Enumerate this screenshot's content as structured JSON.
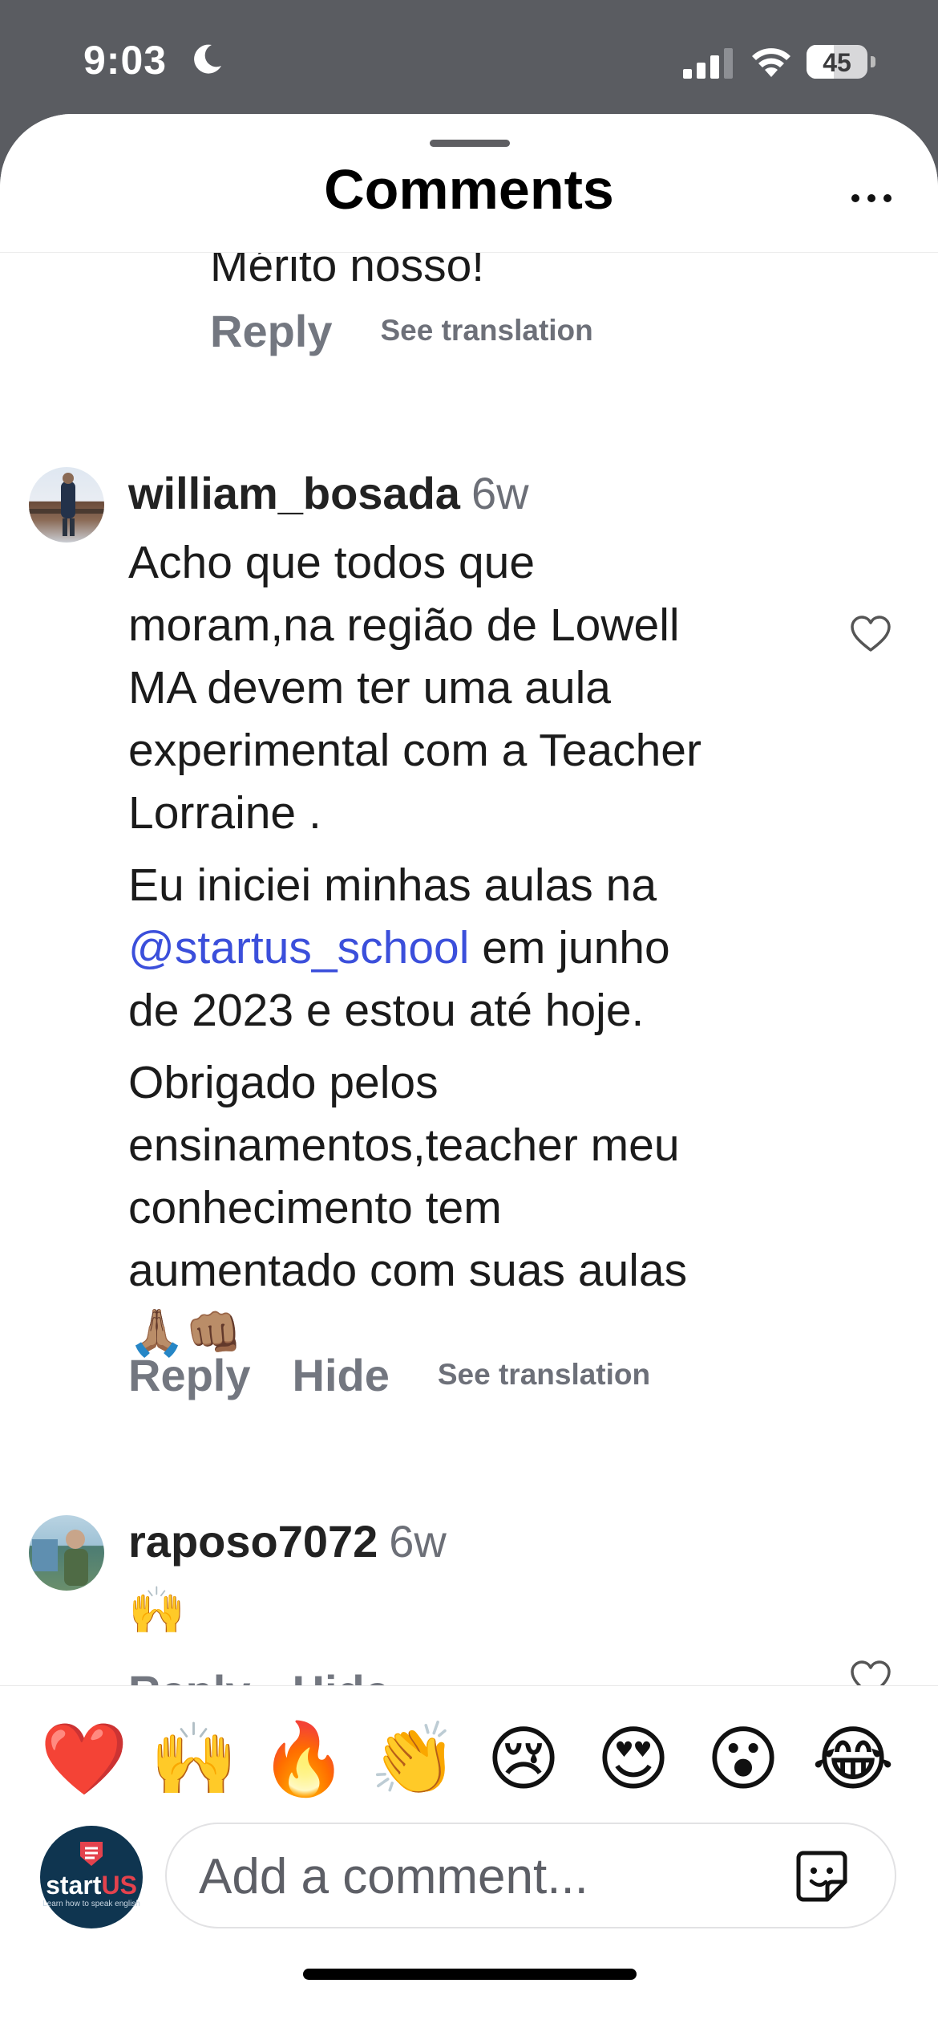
{
  "status_bar": {
    "time": "9:03",
    "battery": "45",
    "battery_level": 0.45
  },
  "header": {
    "title": "Comments"
  },
  "comments": [
    {
      "text_lines": [
        "Mérito nosso!"
      ],
      "actions": {
        "reply": "Reply",
        "translate": "See translation"
      }
    },
    {
      "username": "william_bosada",
      "age": "6w",
      "para1_lines": [
        "Acho que todos que",
        "moram,na região de Lowell",
        "MA devem ter uma aula",
        "experimental com a Teacher",
        "Lorraine ."
      ],
      "para2_line1": "Eu iniciei minhas aulas na",
      "para2_mention": "@startus_school",
      "para2_after_mention": " em junho",
      "para2_line3": "de 2023 e estou até hoje.",
      "para3_lines": [
        "Obrigado pelos",
        "ensinamentos,teacher meu",
        "conhecimento tem",
        "aumentado com suas aulas",
        "🙏🏽👊🏽"
      ],
      "actions": {
        "reply": "Reply",
        "hide": "Hide",
        "translate": "See translation"
      }
    },
    {
      "username": "raposo7072",
      "age": "6w",
      "text": "🙌",
      "actions": {
        "reply": "Reply",
        "hide": "Hide"
      }
    }
  ],
  "quick_reactions": [
    "❤️",
    "🙌",
    "🔥",
    "👏",
    "😢",
    "😍",
    "😮",
    "😂"
  ],
  "composer": {
    "placeholder": "Add a comment...",
    "avatar_brand": "start",
    "avatar_brand_accent": "US",
    "avatar_tagline": "Learn how to speak english"
  },
  "colors": {
    "mention": "#3b4fdb",
    "action_text": "#737780",
    "heart_outline": "#555"
  }
}
